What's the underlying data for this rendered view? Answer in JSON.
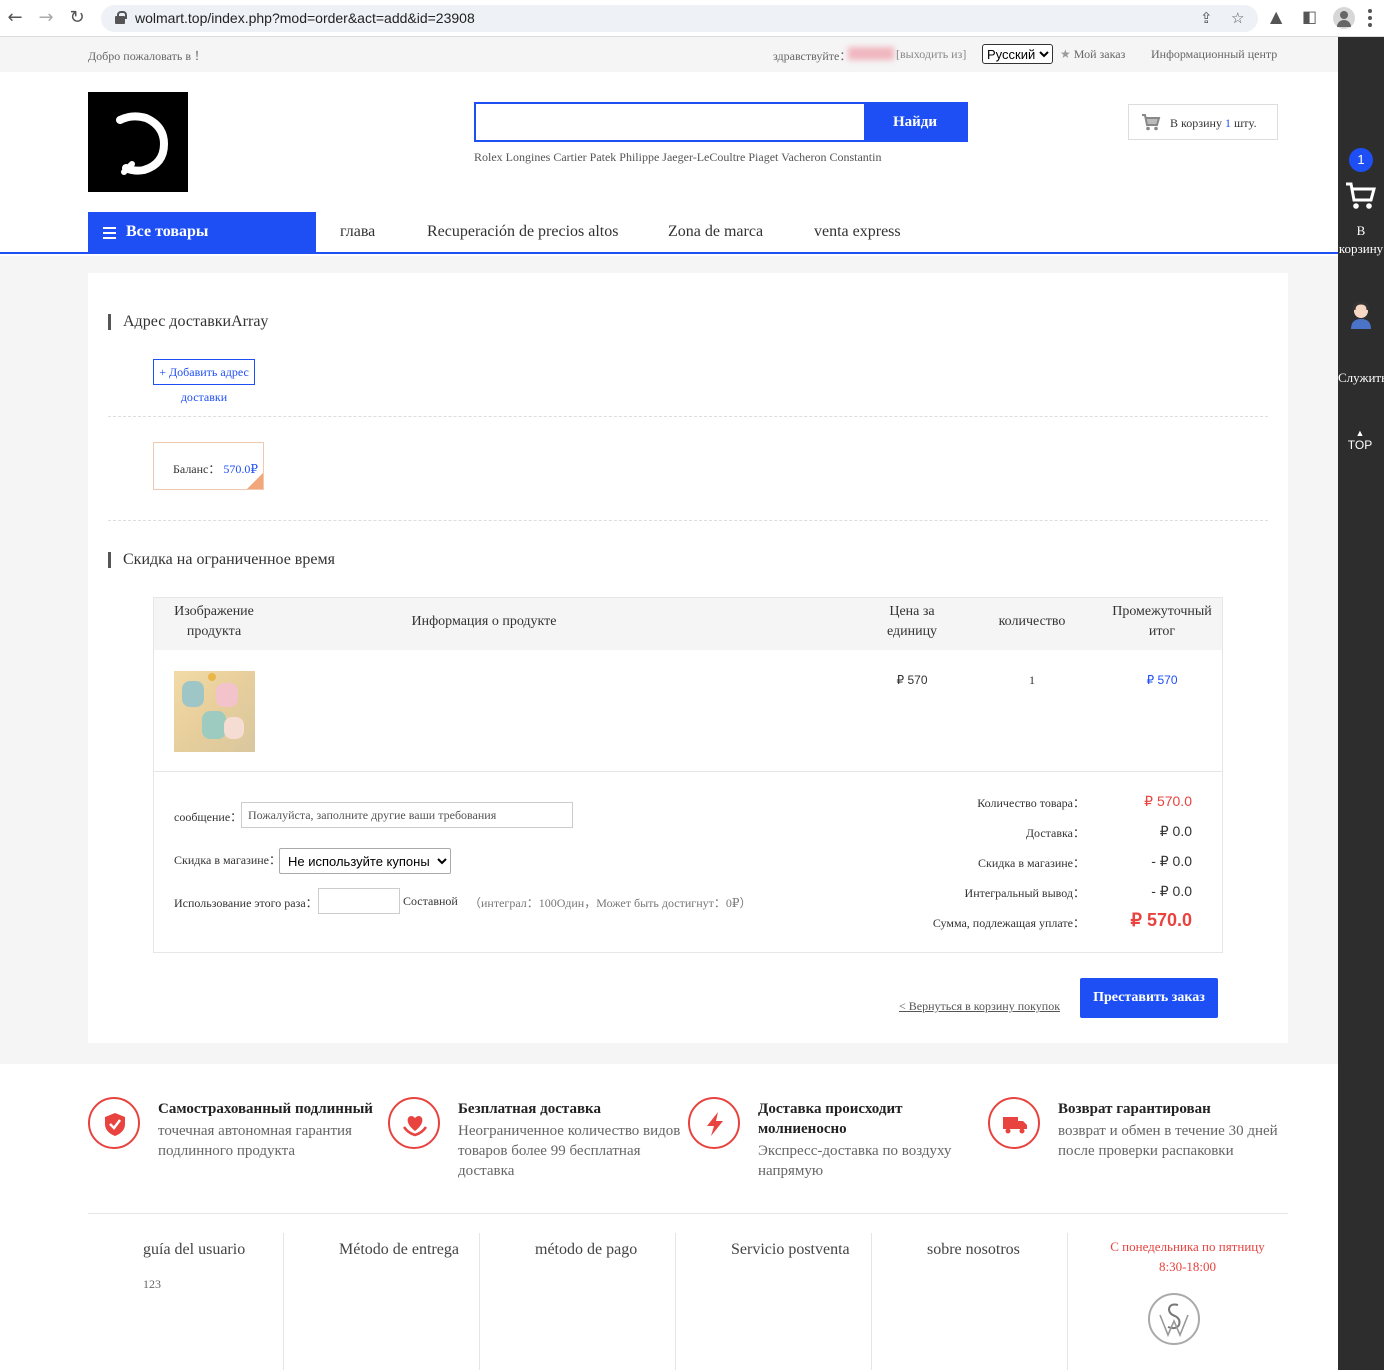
{
  "browser": {
    "url": "wolmart.top/index.php?mod=order&act=add&id=23908"
  },
  "topbar": {
    "welcome": "Добро пожаловать в ！",
    "hello": "здравствуйте：",
    "logout": "[выходить из]",
    "language": "Русский",
    "my_order": "Мой заказ",
    "info_center": "Информационный центр"
  },
  "header": {
    "search_button": "Найди",
    "search_value": "",
    "hot_words": "Rolex Longines Cartier Patek Philippe Jaeger-LeCoultre Piaget Vacheron Constantin",
    "cart_prefix": "В корзину",
    "cart_count": "1",
    "cart_suffix": "штy."
  },
  "nav": {
    "all_products": "Все товары",
    "items": [
      "глава",
      "Recuperación de precios altos",
      "Zona de marca",
      "venta express"
    ]
  },
  "order": {
    "address_title": "Адрес доставкиArray",
    "add_address_line1": "+ Добавить адрес",
    "add_address_line2": "доставки",
    "balance_label": "Баланс：",
    "balance_value": "570.0₽",
    "discount_title": "Скидка на ограниченное время",
    "table_headers": {
      "image": "Изображение продукта",
      "info": "Информация о продукте",
      "unit_price": "Цена за единицу",
      "quantity": "количество",
      "subtotal": "Промежуточный итог"
    },
    "item": {
      "unit_price": "₽ 570",
      "quantity": "1",
      "subtotal": "₽ 570"
    },
    "message_label": "сообщение：",
    "message_placeholder": "Пожалуйста, заполните другие ваши требования",
    "store_discount_label": "Скидка в магазине：",
    "coupon_option": "Не используйте купоны",
    "use_points_label": "Использование этого раза：",
    "points_unit": "Составной",
    "points_note": "（интеграл：100Один，Может быть достигнут：0₽）",
    "summary": [
      {
        "label": "Количество товара：",
        "value": "₽ 570.0"
      },
      {
        "label": "Доставка：",
        "value": "₽ 0.0"
      },
      {
        "label": "Скидка в магазине：",
        "value": "- ₽ 0.0"
      },
      {
        "label": "Интегральный вывод：",
        "value": "- ₽ 0.0"
      },
      {
        "label": "Сумма, подлежащая уплате：",
        "value": "₽ 570.0"
      }
    ],
    "back_link": "< Вернуться в корзину покупок",
    "submit": "Преставить заказ"
  },
  "features": [
    {
      "title": "Самострахованный подлинный",
      "desc": "точечная автономная гарантия подлинного продукта"
    },
    {
      "title": "Безплатная доставка",
      "desc": "Неограниченное количество видов товаров более 99 бесплатная доставка"
    },
    {
      "title": "Доставка происходит молниеносно",
      "desc": "Экспресс-доставка по воздуху напрямую"
    },
    {
      "title": "Возврат гарантирован",
      "desc": "возврат и обмен в течение 30 дней после проверки распаковки"
    }
  ],
  "footer": {
    "cols": [
      "guía del usuario",
      "Método de entrega",
      "método de pago",
      "Servicio postventa",
      "sobre nosotros"
    ],
    "col1_sub": "123",
    "hours_line1": "С понедельника по пятницу",
    "hours_line2": "8:30-18:00"
  },
  "sidebar": {
    "cart_badge": "1",
    "cart_label": "В корзину",
    "service_label": "Служить",
    "top_label": "TOP"
  },
  "colors": {
    "accent": "#1e4ff5",
    "price_red": "#e8433f"
  }
}
